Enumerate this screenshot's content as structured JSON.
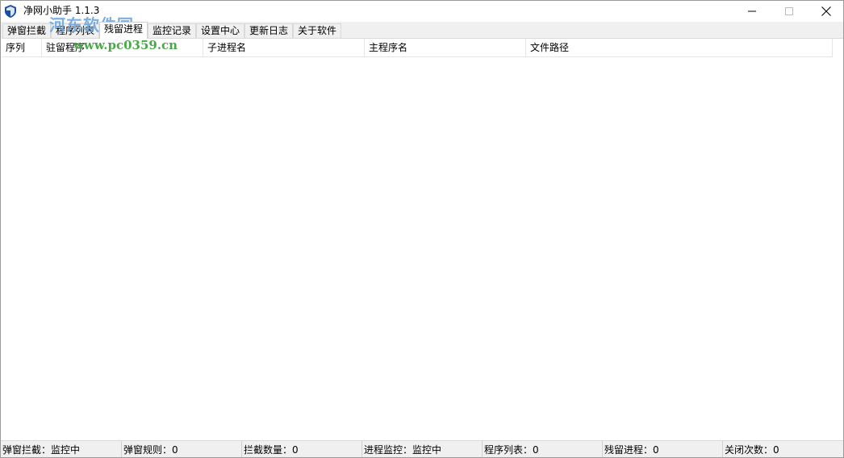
{
  "window": {
    "title": "净网小助手 1.1.3"
  },
  "watermark": {
    "logo": "河东软件园",
    "url": "www.pc0359.cn"
  },
  "tabs": [
    {
      "label": "弹窗拦截"
    },
    {
      "label": "程序列表"
    },
    {
      "label": "残留进程"
    },
    {
      "label": "监控记录"
    },
    {
      "label": "设置中心"
    },
    {
      "label": "更新日志"
    },
    {
      "label": "关于软件"
    }
  ],
  "active_tab": "残留进程",
  "table": {
    "columns": [
      {
        "label": "序列"
      },
      {
        "label": "驻留程序"
      },
      {
        "label": "子进程名"
      },
      {
        "label": "主程序名"
      },
      {
        "label": "文件路径"
      }
    ],
    "rows": []
  },
  "statusbar": {
    "items": [
      {
        "text": "弹窗拦截：监控中"
      },
      {
        "text": "弹窗规则：0"
      },
      {
        "text": "拦截数量：0"
      },
      {
        "text": "进程监控：监控中"
      },
      {
        "text": "程序列表：0"
      },
      {
        "text": "残留进程：0"
      },
      {
        "text": "关闭次数：0"
      }
    ]
  },
  "colors": {
    "icon_blue": "#1a4ea3",
    "watermark_blue": "#6fa7de",
    "watermark_green": "#4aa84a"
  },
  "icons": {
    "app": "shield-icon",
    "minimize": "minimize-icon",
    "maximize": "maximize-icon",
    "close": "close-icon"
  }
}
